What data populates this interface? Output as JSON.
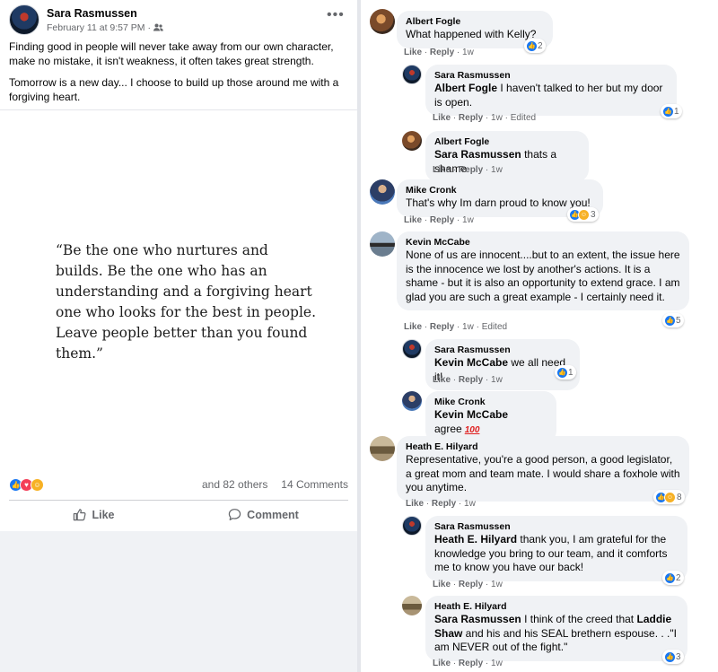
{
  "post": {
    "author": "Sara Rasmussen",
    "date": "February 11 at 9:57 PM",
    "audience_sep": "·",
    "paragraphs": [
      "Finding good in people will never take away from our own character, make no mistake, it isn't weakness, it often takes great strength.",
      "Tomorrow is a new day... I choose to build up those around me with a forgiving heart."
    ],
    "image_quote": "“Be the one who nurtures and builds. Be the one who has an understanding and a forgiving heart one who looks for the best in people. Leave people better than you found them.”",
    "reactions_others": "and 82 others",
    "comments_count": "14 Comments",
    "like_label": "Like",
    "comment_label": "Comment"
  },
  "comments": [
    {
      "name": "Albert Fogle",
      "text": "What happened with Kelly?",
      "actions": {
        "like": "Like",
        "reply": "Reply",
        "time": "1w"
      },
      "reaction_count": "2"
    },
    {
      "name": "Sara Rasmussen",
      "mention": "Albert Fogle",
      "text": " I haven't talked to her but my door is open.",
      "actions": {
        "like": "Like",
        "reply": "Reply",
        "time": "1w",
        "edited": "Edited"
      },
      "reaction_count": "1"
    },
    {
      "name": "Albert Fogle",
      "mention": "Sara Rasmussen",
      "text": " thats a shame",
      "actions": {
        "like": "Like",
        "reply": "Reply",
        "time": "1w"
      }
    },
    {
      "name": "Mike Cronk",
      "text": "That's why Im darn proud to know you!",
      "actions": {
        "like": "Like",
        "reply": "Reply",
        "time": "1w"
      },
      "reaction_count": "3"
    },
    {
      "name": "Kevin McCabe",
      "text": "None of us are innocent....but to an extent, the issue here is the innocence we lost by another's actions. It is a shame - but it is also an opportunity to extend grace. I am glad you are such a great example - I certainly need it.",
      "actions": {
        "like": "Like",
        "reply": "Reply",
        "time": "1w",
        "edited": "Edited"
      },
      "reaction_count": "5"
    },
    {
      "name": "Sara Rasmussen",
      "mention": "Kevin McCabe",
      "text": " we all need it!",
      "actions": {
        "like": "Like",
        "reply": "Reply",
        "time": "1w"
      },
      "reaction_count": "1"
    },
    {
      "name": "Mike Cronk",
      "mention": "Kevin McCabe",
      "text": " agree",
      "emoji": "100"
    },
    {
      "name": "Heath E. Hilyard",
      "text": "Representative, you're a good person, a good legislator, a great mom and team mate. I would share a foxhole with you anytime.",
      "actions": {
        "like": "Like",
        "reply": "Reply",
        "time": "1w"
      },
      "reaction_count": "8"
    },
    {
      "name": "Sara Rasmussen",
      "mention": "Heath E. Hilyard",
      "text": " thank you, I am grateful for the knowledge you bring to our team, and it comforts me to know you have our back!",
      "actions": {
        "like": "Like",
        "reply": "Reply",
        "time": "1w"
      },
      "reaction_count": "2"
    },
    {
      "name": "Heath E. Hilyard",
      "mention": "Sara Rasmussen",
      "text_1": " I think of the creed that ",
      "mention_2": "Laddie Shaw",
      "text_2": " and his and his SEAL brethern espouse. . .\"I am NEVER out of the fight.\"",
      "actions": {
        "like": "Like",
        "reply": "Reply",
        "time": "1w"
      },
      "reaction_count": "3"
    }
  ],
  "colors": {
    "like_blue": "#1877f2",
    "love_red": "#f33e58",
    "care_yellow": "#f7b125",
    "bubble_gray": "#f0f2f5",
    "secondary_text": "#65676b"
  },
  "icons": {
    "like": "thumbs-up-icon",
    "comment": "speech-bubble-icon",
    "audience": "friends-icon",
    "more": "more-dots-icon"
  }
}
